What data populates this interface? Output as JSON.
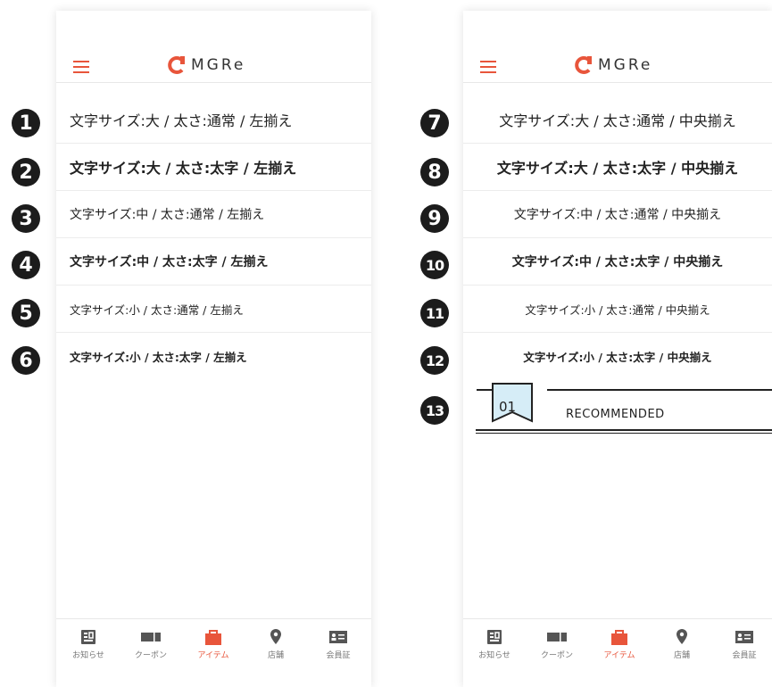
{
  "brand": {
    "name": "MGRe",
    "accent": "#e8553b",
    "text_color": "#333333"
  },
  "left_screen": {
    "rows": [
      {
        "marker": "1",
        "text": "文字サイズ:大 / 太さ:通常 / 左揃え"
      },
      {
        "marker": "2",
        "text": "文字サイズ:大 / 太さ:太字 / 左揃え"
      },
      {
        "marker": "3",
        "text": "文字サイズ:中 / 太さ:通常 / 左揃え"
      },
      {
        "marker": "4",
        "text": "文字サイズ:中 / 太さ:太字 / 左揃え"
      },
      {
        "marker": "5",
        "text": "文字サイズ:小 / 太さ:通常 / 左揃え"
      },
      {
        "marker": "6",
        "text": "文字サイズ:小 / 太さ:太字 / 左揃え"
      }
    ]
  },
  "right_screen": {
    "rows": [
      {
        "marker": "7",
        "text": "文字サイズ:大 / 太さ:通常 / 中央揃え"
      },
      {
        "marker": "8",
        "text": "文字サイズ:大 / 太さ:太字 / 中央揃え"
      },
      {
        "marker": "9",
        "text": "文字サイズ:中 / 太さ:通常 / 中央揃え"
      },
      {
        "marker": "10",
        "text": "文字サイズ:中 / 太さ:太字 / 中央揃え"
      },
      {
        "marker": "11",
        "text": "文字サイズ:小 / 太さ:通常 / 中央揃え"
      },
      {
        "marker": "12",
        "text": "文字サイズ:小 / 太さ:太字 / 中央揃え"
      }
    ],
    "recommended": {
      "marker": "13",
      "number": "01",
      "label": "RECOMMENDED"
    }
  },
  "tabbar": {
    "items": [
      {
        "label": "お知らせ",
        "icon": "news-icon"
      },
      {
        "label": "クーポン",
        "icon": "coupon-icon"
      },
      {
        "label": "アイテム",
        "icon": "shopping-bag-icon",
        "active": true
      },
      {
        "label": "店舗",
        "icon": "map-pin-icon"
      },
      {
        "label": "会員証",
        "icon": "member-card-icon"
      }
    ]
  }
}
